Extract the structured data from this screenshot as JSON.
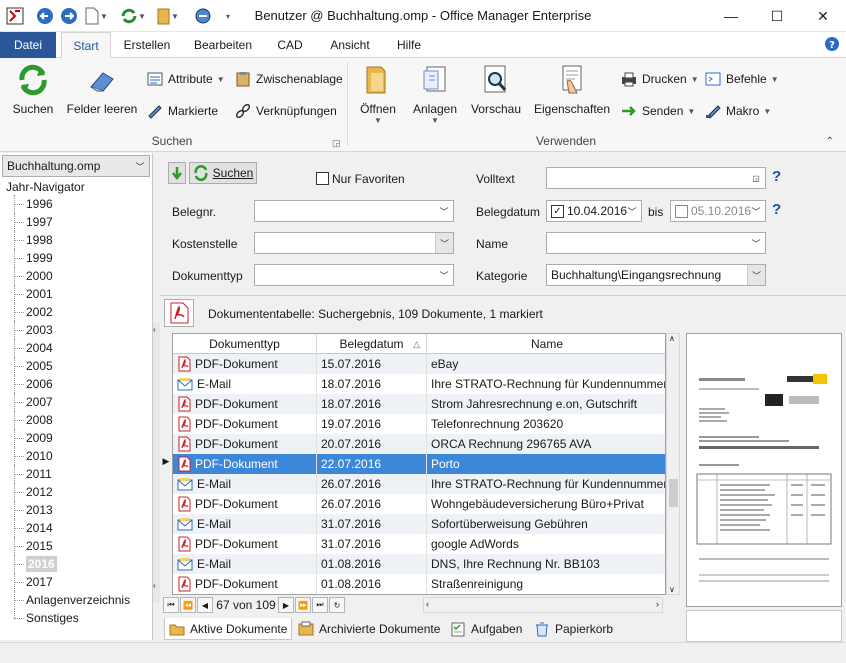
{
  "window": {
    "title": "Benutzer @ Buchhaltung.omp - Office Manager Enterprise",
    "minimize": "—",
    "maximize": "☐",
    "close": "✕"
  },
  "ribbon_tabs": [
    "Datei",
    "Start",
    "Erstellen",
    "Bearbeiten",
    "CAD",
    "Ansicht",
    "Hilfe"
  ],
  "ribbon": {
    "suchen": "Suchen",
    "felder_leeren": "Felder leeren",
    "attribute": "Attribute",
    "zwischenablage": "Zwischenablage",
    "markierte": "Markierte",
    "verknuepfungen": "Verknüpfungen",
    "group_suchen": "Suchen",
    "oeffnen": "Öffnen",
    "anlagen": "Anlagen",
    "vorschau": "Vorschau",
    "eigenschaften": "Eigenschaften",
    "drucken": "Drucken",
    "befehle": "Befehle",
    "senden": "Senden",
    "makro": "Makro",
    "group_verwenden": "Verwenden"
  },
  "navigator": {
    "database": "Buchhaltung.omp",
    "header": "Jahr-Navigator",
    "items": [
      "1996",
      "1997",
      "1998",
      "1999",
      "2000",
      "2001",
      "2002",
      "2003",
      "2004",
      "2005",
      "2006",
      "2007",
      "2008",
      "2009",
      "2010",
      "2011",
      "2012",
      "2013",
      "2014",
      "2015",
      "2016",
      "2017",
      "Anlagenverzeichnis",
      "Sonstiges"
    ],
    "selected": "2016"
  },
  "search": {
    "suchen_button": "Suchen",
    "nur_favoriten": "Nur Favoriten",
    "volltext_label": "Volltext",
    "belegnr_label": "Belegnr.",
    "kostenstelle_label": "Kostenstelle",
    "dokumenttyp_label": "Dokumenttyp",
    "belegdatum_label": "Belegdatum",
    "date_from": "10.04.2016",
    "bis_label": "bis",
    "date_to": "05.10.2016",
    "name_label": "Name",
    "kategorie_label": "Kategorie",
    "kategorie_value": "Buchhaltung\\Eingangsrechnung",
    "help": "?"
  },
  "table": {
    "caption": "Dokumententabelle: Suchergebnis, 109 Dokumente, 1 markiert",
    "columns": [
      "Dokumenttyp",
      "Belegdatum",
      "Name"
    ],
    "sort_indicator": "△",
    "rows": [
      {
        "type": "PDF-Dokument",
        "icon": "pdf",
        "date": "15.07.2016",
        "name": "eBay"
      },
      {
        "type": "E-Mail",
        "icon": "mail",
        "date": "18.07.2016",
        "name": "Ihre STRATO-Rechnung für Kundennummer"
      },
      {
        "type": "PDF-Dokument",
        "icon": "pdf",
        "date": "18.07.2016",
        "name": "Strom Jahresrechnung e.on, Gutschrift"
      },
      {
        "type": "PDF-Dokument",
        "icon": "pdf",
        "date": "19.07.2016",
        "name": "Telefonrechnung 203620"
      },
      {
        "type": "PDF-Dokument",
        "icon": "pdf",
        "date": "20.07.2016",
        "name": "ORCA Rechnung 296765 AVA"
      },
      {
        "type": "PDF-Dokument",
        "icon": "pdf",
        "date": "22.07.2016",
        "name": "Porto"
      },
      {
        "type": "E-Mail",
        "icon": "mail",
        "date": "26.07.2016",
        "name": "Ihre STRATO-Rechnung für Kundennummer"
      },
      {
        "type": "PDF-Dokument",
        "icon": "pdf",
        "date": "26.07.2016",
        "name": "Wohngebäudeversicherung Büro+Privat"
      },
      {
        "type": "E-Mail",
        "icon": "mail",
        "date": "31.07.2016",
        "name": "Sofortüberweisung Gebühren"
      },
      {
        "type": "PDF-Dokument",
        "icon": "pdf",
        "date": "31.07.2016",
        "name": "google AdWords"
      },
      {
        "type": "E-Mail",
        "icon": "mail",
        "date": "01.08.2016",
        "name": "DNS, Ihre Rechnung Nr. BB103"
      },
      {
        "type": "PDF-Dokument",
        "icon": "pdf",
        "date": "01.08.2016",
        "name": "Straßenreinigung"
      }
    ],
    "selected_index": 5,
    "record_position": "67 von 109"
  },
  "bottom_tabs": [
    "Aktive Dokumente",
    "Archivierte Dokumente",
    "Aufgaben",
    "Papierkorb"
  ],
  "colors": {
    "accent": "#2b579a",
    "selection": "#3d87d8",
    "pdf_red": "#c8202a"
  }
}
